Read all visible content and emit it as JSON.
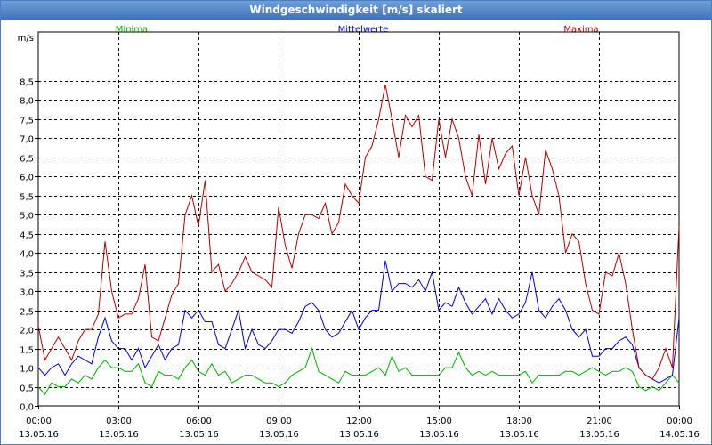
{
  "window": {
    "title": "Windgeschwindigkeit [m/s] skaliert"
  },
  "chart_data": {
    "type": "line",
    "title": "Windgeschwindigkeit [m/s] skaliert",
    "ylabel": "m/s",
    "xlabel": "",
    "ylim": [
      0,
      9.5
    ],
    "y_ticks": [
      "0,0",
      "0,5",
      "1,0",
      "1,5",
      "2,0",
      "2,5",
      "3,0",
      "3,5",
      "4,0",
      "4,5",
      "5,0",
      "5,5",
      "6,0",
      "6,5",
      "7,0",
      "7,5",
      "8,0",
      "8,5"
    ],
    "x_ticks": [
      {
        "time": "00:00",
        "date": "13.05.16"
      },
      {
        "time": "03:00",
        "date": "13.05.16"
      },
      {
        "time": "06:00",
        "date": "13.05.16"
      },
      {
        "time": "09:00",
        "date": "13.05.16"
      },
      {
        "time": "12:00",
        "date": "13.05.16"
      },
      {
        "time": "15:00",
        "date": "13.05.16"
      },
      {
        "time": "18:00",
        "date": "13.05.16"
      },
      {
        "time": "21:00",
        "date": "13.05.16"
      },
      {
        "time": "00:00",
        "date": "14.05.16"
      }
    ],
    "x_range_hours": [
      0,
      24
    ],
    "grid": true,
    "legend_position": "top",
    "series": [
      {
        "name": "Minima",
        "color": "#00aa00",
        "x_hours": [
          0,
          0.25,
          0.5,
          0.75,
          1,
          1.25,
          1.5,
          1.75,
          2,
          2.25,
          2.5,
          2.75,
          3,
          3.25,
          3.5,
          3.75,
          4,
          4.25,
          4.5,
          4.75,
          5,
          5.25,
          5.5,
          5.75,
          6,
          6.25,
          6.5,
          6.75,
          7,
          7.25,
          7.5,
          7.75,
          8,
          8.25,
          8.5,
          8.75,
          9,
          9.25,
          9.5,
          9.75,
          10,
          10.25,
          10.5,
          10.75,
          11,
          11.25,
          11.5,
          11.75,
          12,
          12.25,
          12.5,
          12.75,
          13,
          13.25,
          13.5,
          13.75,
          14,
          14.25,
          14.5,
          14.75,
          15,
          15.25,
          15.5,
          15.75,
          16,
          16.25,
          16.5,
          16.75,
          17,
          17.25,
          17.5,
          17.75,
          18,
          18.25,
          18.5,
          18.75,
          19,
          19.25,
          19.5,
          19.75,
          20,
          20.25,
          20.5,
          20.75,
          21,
          21.25,
          21.5,
          21.75,
          22,
          22.25,
          22.5,
          22.75,
          23,
          23.25,
          23.5,
          23.75,
          24
        ],
        "values": [
          0.5,
          0.3,
          0.6,
          0.5,
          0.5,
          0.7,
          0.6,
          0.8,
          0.7,
          1.0,
          1.2,
          1.0,
          1.0,
          0.9,
          0.9,
          1.1,
          0.6,
          0.5,
          0.9,
          0.8,
          0.8,
          0.7,
          1.0,
          1.2,
          0.9,
          0.8,
          1.1,
          0.8,
          0.9,
          0.6,
          0.7,
          0.8,
          0.8,
          0.7,
          0.6,
          0.6,
          0.5,
          0.6,
          0.8,
          0.9,
          1.0,
          1.5,
          0.9,
          0.8,
          0.7,
          0.6,
          0.9,
          0.8,
          0.8,
          0.8,
          0.9,
          1.0,
          0.8,
          1.3,
          0.9,
          1.0,
          0.8,
          0.8,
          0.8,
          0.8,
          0.8,
          1.0,
          1.0,
          1.4,
          1.0,
          0.8,
          0.9,
          0.8,
          0.9,
          0.8,
          0.8,
          0.8,
          0.8,
          0.9,
          0.6,
          0.8,
          0.8,
          0.8,
          0.8,
          0.9,
          0.9,
          0.8,
          0.9,
          1.0,
          0.9,
          0.8,
          0.9,
          0.9,
          1.0,
          0.9,
          0.5,
          0.4,
          0.5,
          0.4,
          0.6,
          0.8,
          0.6,
          0.5,
          0.5
        ]
      },
      {
        "name": "Mittelwerte",
        "color": "#0000cc",
        "x_hours": [
          0,
          0.25,
          0.5,
          0.75,
          1,
          1.25,
          1.5,
          1.75,
          2,
          2.25,
          2.5,
          2.75,
          3,
          3.25,
          3.5,
          3.75,
          4,
          4.25,
          4.5,
          4.75,
          5,
          5.25,
          5.5,
          5.75,
          6,
          6.25,
          6.5,
          6.75,
          7,
          7.25,
          7.5,
          7.75,
          8,
          8.25,
          8.5,
          8.75,
          9,
          9.25,
          9.5,
          9.75,
          10,
          10.25,
          10.5,
          10.75,
          11,
          11.25,
          11.5,
          11.75,
          12,
          12.25,
          12.5,
          12.75,
          13,
          13.25,
          13.5,
          13.75,
          14,
          14.25,
          14.5,
          14.75,
          15,
          15.25,
          15.5,
          15.75,
          16,
          16.25,
          16.5,
          16.75,
          17,
          17.25,
          17.5,
          17.75,
          18,
          18.25,
          18.5,
          18.75,
          19,
          19.25,
          19.5,
          19.75,
          20,
          20.25,
          20.5,
          20.75,
          21,
          21.25,
          21.5,
          21.75,
          22,
          22.25,
          22.5,
          22.75,
          23,
          23.25,
          23.5,
          23.75,
          24
        ],
        "values": [
          1.0,
          0.8,
          1.0,
          1.1,
          0.8,
          1.1,
          1.3,
          1.2,
          1.1,
          1.8,
          2.3,
          1.7,
          1.5,
          1.5,
          1.2,
          1.5,
          1.0,
          1.3,
          1.6,
          1.2,
          1.5,
          1.6,
          2.5,
          2.3,
          2.5,
          2.2,
          2.2,
          1.6,
          1.5,
          2.0,
          2.5,
          1.5,
          2.0,
          1.6,
          1.5,
          1.7,
          2.0,
          2.0,
          1.9,
          2.2,
          2.6,
          2.7,
          2.5,
          2.0,
          1.8,
          1.9,
          2.2,
          2.5,
          2.0,
          2.3,
          2.5,
          2.5,
          3.8,
          3.0,
          3.2,
          3.2,
          3.1,
          3.3,
          3.0,
          3.5,
          2.5,
          2.7,
          2.6,
          3.1,
          2.7,
          2.4,
          2.6,
          2.8,
          2.4,
          2.8,
          2.5,
          2.3,
          2.4,
          2.7,
          3.5,
          2.5,
          2.3,
          2.6,
          2.8,
          2.5,
          2.0,
          1.8,
          2.0,
          1.3,
          1.3,
          1.5,
          1.5,
          1.7,
          1.8,
          1.6,
          1.0,
          0.8,
          0.7,
          0.6,
          0.7,
          0.8,
          2.3,
          1.0,
          1.1
        ]
      },
      {
        "name": "Maxima",
        "color": "#b00000",
        "x_hours": [
          0,
          0.25,
          0.5,
          0.75,
          1,
          1.25,
          1.5,
          1.75,
          2,
          2.25,
          2.5,
          2.75,
          3,
          3.25,
          3.5,
          3.75,
          4,
          4.25,
          4.5,
          4.75,
          5,
          5.25,
          5.5,
          5.75,
          6,
          6.25,
          6.5,
          6.75,
          7,
          7.25,
          7.5,
          7.75,
          8,
          8.25,
          8.5,
          8.75,
          9,
          9.25,
          9.5,
          9.75,
          10,
          10.25,
          10.5,
          10.75,
          11,
          11.25,
          11.5,
          11.75,
          12,
          12.25,
          12.5,
          12.75,
          13,
          13.25,
          13.5,
          13.75,
          14,
          14.25,
          14.5,
          14.75,
          15,
          15.25,
          15.5,
          15.75,
          16,
          16.25,
          16.5,
          16.75,
          17,
          17.25,
          17.5,
          17.75,
          18,
          18.25,
          18.5,
          18.75,
          19,
          19.25,
          19.5,
          19.75,
          20,
          20.25,
          20.5,
          20.75,
          21,
          21.25,
          21.5,
          21.75,
          22,
          22.25,
          22.5,
          22.75,
          23,
          23.25,
          23.5,
          23.75,
          24
        ],
        "values": [
          2.1,
          1.2,
          1.5,
          1.8,
          1.5,
          1.2,
          1.7,
          2.0,
          2.0,
          2.4,
          4.3,
          3.0,
          2.3,
          2.4,
          2.4,
          2.8,
          3.7,
          1.8,
          1.7,
          2.3,
          2.9,
          3.2,
          5.0,
          5.5,
          4.7,
          5.9,
          3.5,
          3.7,
          3.0,
          3.2,
          3.5,
          3.9,
          3.5,
          3.4,
          3.3,
          3.1,
          5.2,
          4.2,
          3.6,
          4.5,
          5.0,
          5.0,
          4.9,
          5.3,
          4.5,
          4.8,
          5.8,
          5.5,
          5.3,
          6.5,
          6.8,
          7.5,
          8.4,
          7.5,
          6.5,
          7.6,
          7.3,
          7.6,
          6.0,
          5.9,
          7.5,
          6.5,
          7.5,
          7.0,
          6.0,
          5.5,
          7.1,
          5.8,
          7.0,
          6.2,
          6.6,
          6.8,
          5.5,
          6.5,
          5.5,
          5.0,
          6.7,
          6.2,
          5.5,
          4.0,
          4.5,
          4.3,
          3.2,
          2.5,
          2.4,
          3.5,
          3.4,
          4.0,
          3.2,
          2.0,
          1.0,
          0.8,
          0.7,
          1.0,
          1.5,
          1.0,
          4.7,
          2.0,
          1.7
        ]
      }
    ]
  }
}
